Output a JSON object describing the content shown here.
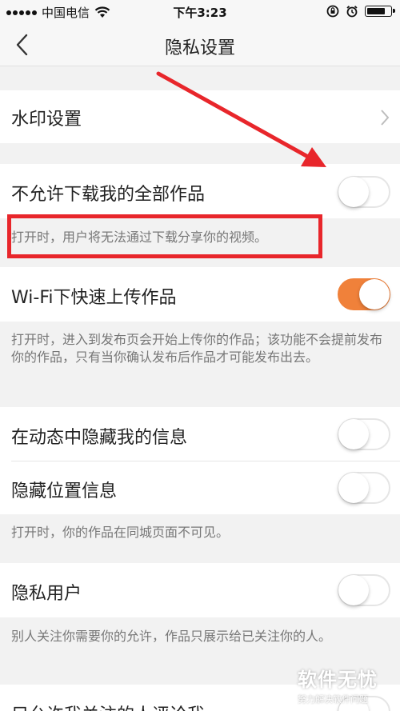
{
  "status_bar": {
    "carrier": "中国电信",
    "time": "下午3:23"
  },
  "nav": {
    "title": "隐私设置"
  },
  "settings": {
    "watermark": {
      "label": "水印设置"
    },
    "no_download": {
      "label": "不允许下载我的全部作品",
      "on": false,
      "note": "打开时，用户将无法通过下载分享你的视频。"
    },
    "wifi_upload": {
      "label": "Wi-Fi下快速上传作品",
      "on": true,
      "note": "打开时，进入到发布页会开始上传你的作品；该功能不会提前发布你的作品，只有当你确认发布后作品才可能发布出去。"
    },
    "hide_in_feed": {
      "label": "在动态中隐藏我的信息",
      "on": false
    },
    "hide_location": {
      "label": "隐藏位置信息",
      "on": false,
      "note": "打开时，你的作品在同城页面不可见。"
    },
    "private_user": {
      "label": "隐私用户",
      "on": false,
      "note": "别人关注你需要你的允许，作品只展示给已关注你的人。"
    },
    "comment_limit": {
      "label": "只允许我关注的人评论我"
    }
  },
  "watermark_overlay": {
    "title": "软件无忧",
    "subtitle": "努力解决软件问题"
  },
  "colors": {
    "toggle_on": "#f0813a",
    "annotation": "#e8262b"
  }
}
